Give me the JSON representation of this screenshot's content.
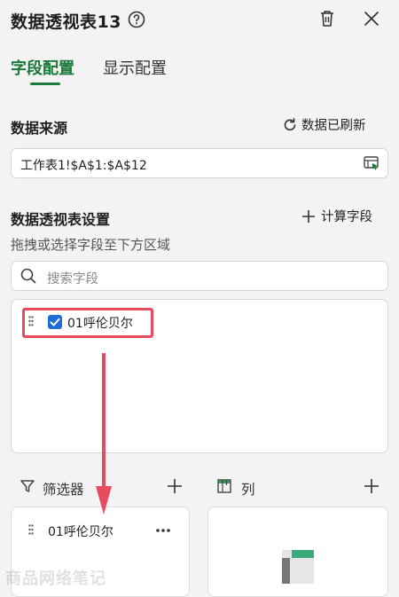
{
  "header": {
    "title": "数据透视表13"
  },
  "tabs": [
    {
      "label": "字段配置",
      "active": true
    },
    {
      "label": "显示配置",
      "active": false
    }
  ],
  "data_source": {
    "title": "数据来源",
    "refresh_label": "数据已刷新",
    "range_value": "工作表1!$A$1:$A$12"
  },
  "pivot_settings": {
    "title": "数据透视表设置",
    "calc_field_label": "计算字段",
    "hint": "拖拽或选择字段至下方区域",
    "search_placeholder": "搜索字段"
  },
  "fields": [
    {
      "label": "01呼伦贝尔",
      "checked": true
    }
  ],
  "areas": {
    "filter": {
      "label": "筛选器",
      "items": [
        "01呼伦贝尔"
      ]
    },
    "columns": {
      "label": "列",
      "items": []
    }
  },
  "watermark": "商品网络笔记",
  "colors": {
    "accent_green": "#1b7a3a",
    "checkbox_blue": "#1e6cd8",
    "annotation_red": "#e84a5f"
  }
}
